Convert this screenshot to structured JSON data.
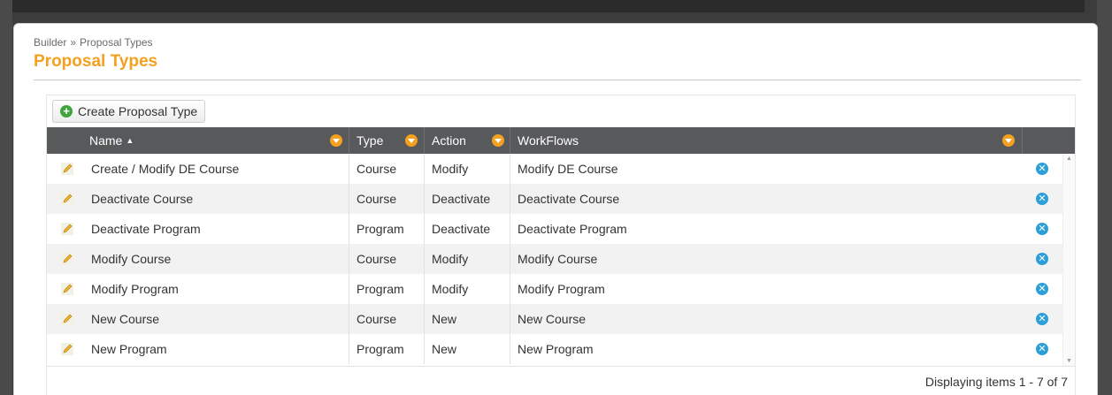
{
  "breadcrumb": {
    "parent": "Builder",
    "separator": "»",
    "current": "Proposal Types"
  },
  "page_title": "Proposal Types",
  "toolbar": {
    "create_label": "Create Proposal Type"
  },
  "columns": {
    "name": "Name",
    "type": "Type",
    "action": "Action",
    "workflows": "WorkFlows"
  },
  "rows": [
    {
      "name": "Create / Modify DE Course",
      "type": "Course",
      "action": "Modify",
      "workflow": "Modify DE Course"
    },
    {
      "name": "Deactivate Course",
      "type": "Course",
      "action": "Deactivate",
      "workflow": "Deactivate Course"
    },
    {
      "name": "Deactivate Program",
      "type": "Program",
      "action": "Deactivate",
      "workflow": "Deactivate Program"
    },
    {
      "name": "Modify Course",
      "type": "Course",
      "action": "Modify",
      "workflow": "Modify Course"
    },
    {
      "name": "Modify Program",
      "type": "Program",
      "action": "Modify",
      "workflow": "Modify Program"
    },
    {
      "name": "New Course",
      "type": "Course",
      "action": "New",
      "workflow": "New Course"
    },
    {
      "name": "New Program",
      "type": "Program",
      "action": "New",
      "workflow": "New Program"
    }
  ],
  "footer": {
    "pager_info": "Displaying items 1 - 7 of 7"
  },
  "icons": {
    "create": "plus-circle-icon",
    "filter": "filter-icon",
    "sort": "sort-asc-icon",
    "edit": "pencil-icon",
    "delete": "close-circle-icon"
  },
  "colors": {
    "accent": "#f5a01f",
    "header_bg": "#58595b",
    "delete": "#2a9fd8",
    "create": "#3fa33f"
  }
}
